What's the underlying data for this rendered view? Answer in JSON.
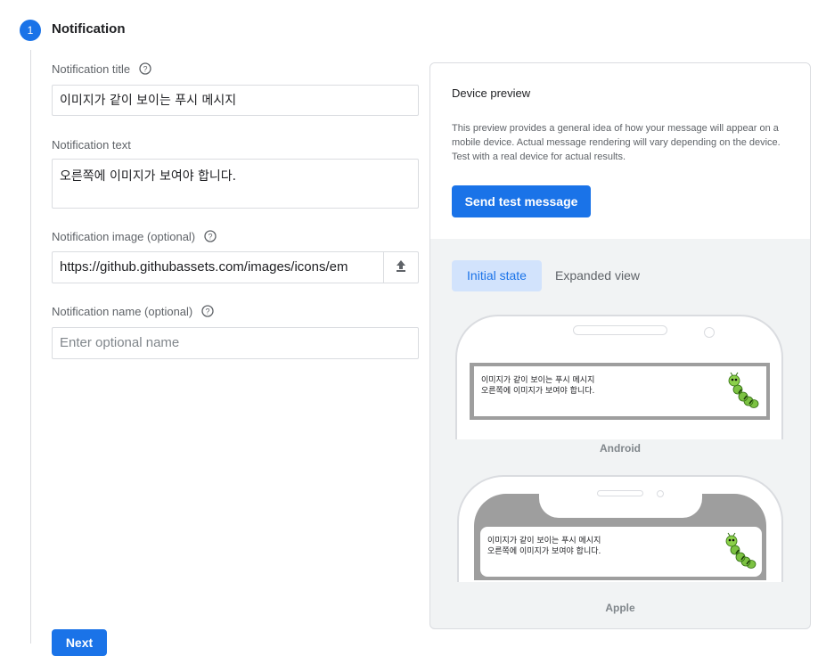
{
  "step": {
    "number": "1",
    "title": "Notification"
  },
  "form": {
    "title_label": "Notification title",
    "title_value": "이미지가 같이 보이는 푸시 메시지",
    "text_label": "Notification text",
    "text_value": "오른쪽에 이미지가 보여야 합니다.",
    "image_label": "Notification image (optional)",
    "image_value": "https://github.githubassets.com/images/icons/em",
    "name_label": "Notification name (optional)",
    "name_placeholder": "Enter optional name",
    "next_label": "Next"
  },
  "preview": {
    "title": "Device preview",
    "description": "This preview provides a general idea of how your message will appear on a mobile device. Actual message rendering will vary depending on the device. Test with a real device for actual results.",
    "send_label": "Send test message",
    "tabs": [
      {
        "label": "Initial state",
        "selected": true
      },
      {
        "label": "Expanded view",
        "selected": false
      }
    ],
    "android_label": "Android",
    "apple_label": "Apple",
    "notif_title": "이미지가 같이 보이는 푸시 메시지",
    "notif_text": "오른쪽에 이미지가 보여야 합니다.",
    "notif_image_icon": "caterpillar-emoji"
  },
  "colors": {
    "primary": "#1a73e8",
    "tab_selected_bg": "#d2e3fc",
    "border": "#dadce0",
    "preview_bg": "#f1f3f4"
  }
}
